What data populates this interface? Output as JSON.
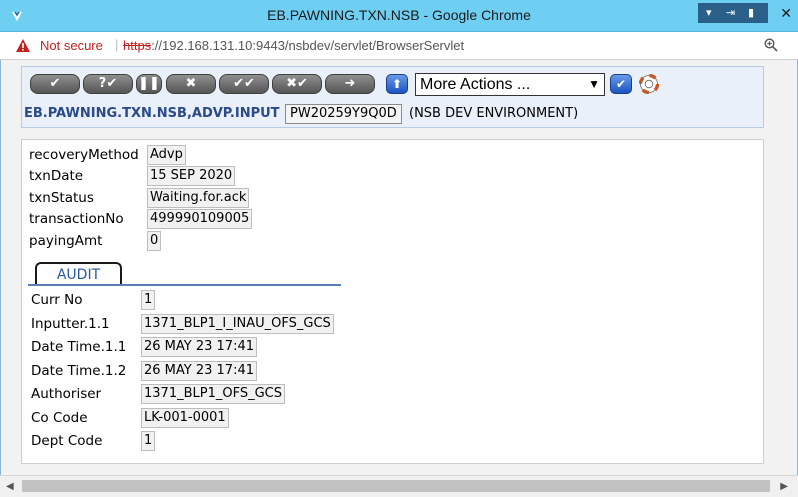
{
  "window": {
    "title": "EB.PAWNING.TXN.NSB - Google Chrome",
    "control_glyphs": [
      "▾",
      "⇥",
      "▮"
    ],
    "close_glyph": "✕"
  },
  "address_bar": {
    "security_label": "Not secure",
    "separator": "|",
    "url_scheme": "https",
    "url_rest": "://192.168.131.10:9443/nsbdev/servlet/BrowserServlet"
  },
  "toolbar": {
    "buttons": [
      {
        "name": "validate-button",
        "glyph": "✔"
      },
      {
        "name": "hold-button",
        "glyph": "?✔"
      },
      {
        "name": "pause-button",
        "glyph": "❚❚"
      },
      {
        "name": "delete-button",
        "glyph": "✖"
      },
      {
        "name": "authorise-button",
        "glyph": "✔✔"
      },
      {
        "name": "reverse-button",
        "glyph": "✖✔"
      },
      {
        "name": "next-button",
        "glyph": "➜"
      }
    ],
    "upload_glyph": "⬆",
    "actions_select_value": "More Actions ...",
    "go_glyph": "✔",
    "help_icon": "lifebuoy-icon"
  },
  "header": {
    "app_name": "EB.PAWNING.TXN.NSB,ADVP.INPUT",
    "record_id": "PW20259Y9Q0D",
    "environment": "(NSB DEV ENVIRONMENT)"
  },
  "fields": [
    {
      "label": "recoveryMethod",
      "value": "Advp"
    },
    {
      "label": "txnDate",
      "value": "15 SEP 2020"
    },
    {
      "label": "txnStatus",
      "value": "Waiting.for.ack"
    },
    {
      "label": "transactionNo",
      "value": "499990109005"
    },
    {
      "label": "payingAmt",
      "value": "0"
    }
  ],
  "audit": {
    "tab_label": "AUDIT",
    "fields": [
      {
        "label": "Curr No",
        "value": "1"
      },
      {
        "label": "Inputter.1.1",
        "value": "1371_BLP1_I_INAU_OFS_GCS"
      },
      {
        "label": "Date Time.1.1",
        "value": "26 MAY 23 17:41"
      },
      {
        "label": "Date Time.1.2",
        "value": "26 MAY 23 17:41"
      },
      {
        "label": "Authoriser",
        "value": "1371_BLP1_OFS_GCS"
      },
      {
        "label": "Co Code",
        "value": "LK-001-0001"
      },
      {
        "label": "Dept Code",
        "value": "1"
      }
    ]
  },
  "scrollbar": {
    "left_glyph": "◀",
    "right_glyph": "▶"
  },
  "colors": {
    "titlebar": "#6fcff3",
    "not_secure": "#c5221f",
    "app_title": "#2a4a8a",
    "panel": "#e9f0f9"
  }
}
